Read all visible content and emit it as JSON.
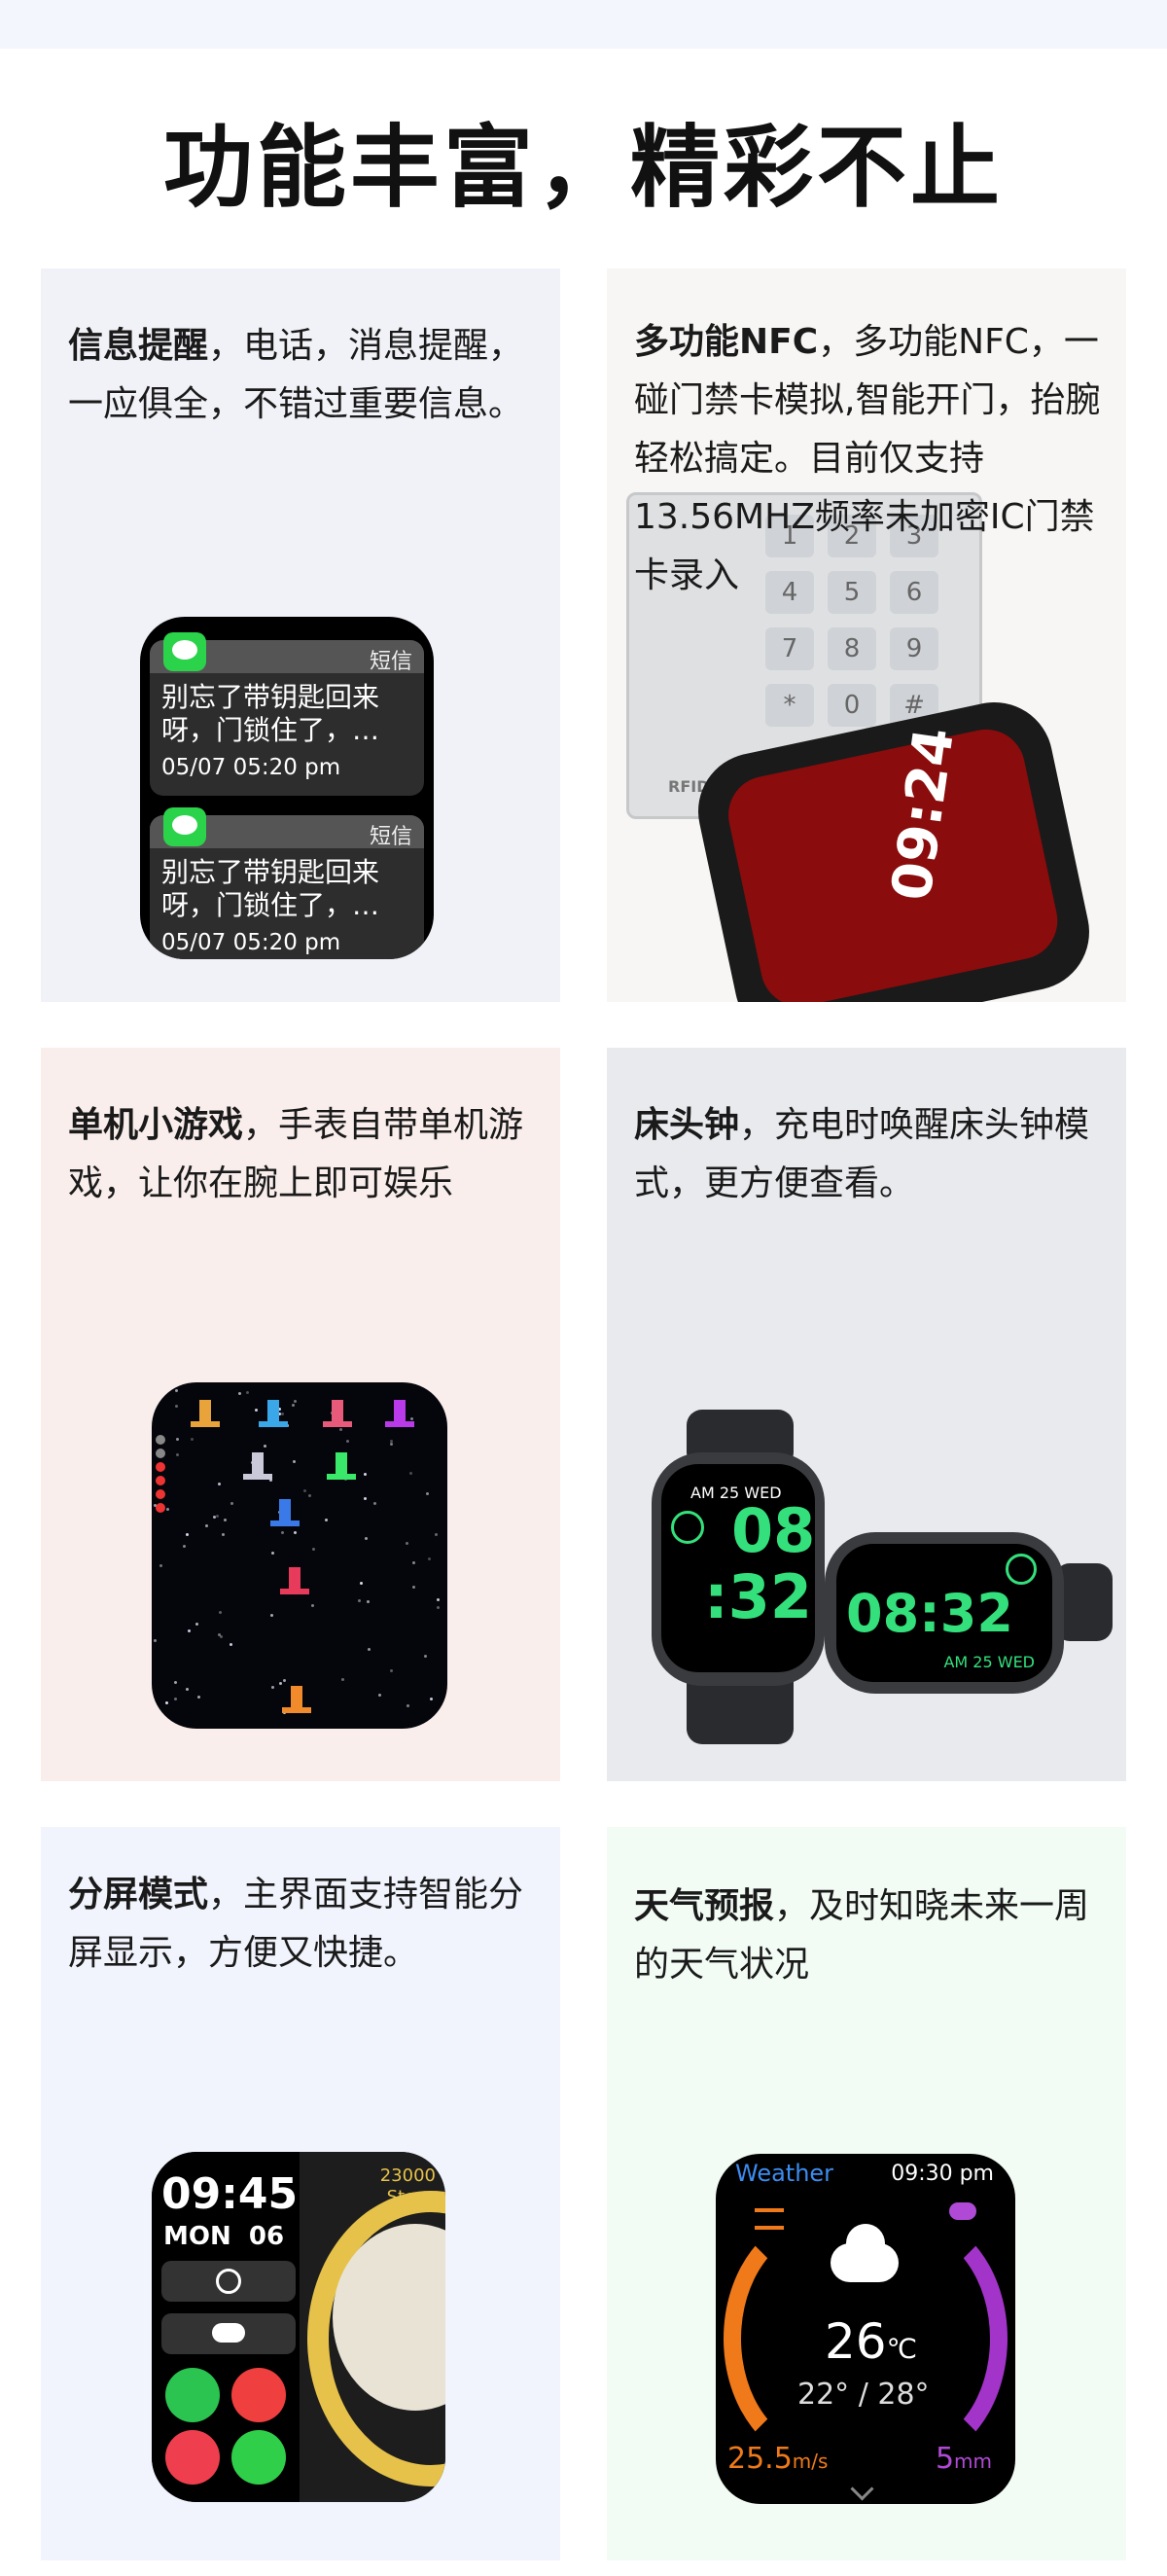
{
  "page_title": "功能丰富，精彩不止",
  "cards": [
    {
      "title_bold": "信息提醒",
      "text": "，电话，消息提醒，一应俱全，不错过重要信息。",
      "notifications": [
        {
          "source": "短信",
          "message": "别忘了带钥匙回来呀，门锁住了，…",
          "time": "05/07  05:20 pm"
        },
        {
          "source": "短信",
          "message": "别忘了带钥匙回来呀，门锁住了，…",
          "time": "05/07  05:20 pm"
        }
      ]
    },
    {
      "title_bold": "多功能NFC",
      "text": "，多功能NFC，一碰门禁卡模拟,智能开门，抬腕轻松搞定。目前仅支持13.56MHZ频率未加密IC门禁卡录入",
      "keypad_keys": [
        "1",
        "2",
        "3",
        "4",
        "5",
        "6",
        "7",
        "8",
        "9",
        "*",
        "0",
        "#"
      ],
      "keypad_label": "RFID ACCESS CONTROL",
      "watch_time": "09:24"
    },
    {
      "title_bold": "单机小游戏",
      "text": "，手表自带单机游戏，让你在腕上即可娱乐"
    },
    {
      "title_bold": "床头钟",
      "text": "，充电时唤醒床头钟模式，更方便查看。",
      "watch1": {
        "date": "AM 25 WED",
        "hour": "08",
        "minute": ":32"
      },
      "watch2": {
        "time": "08:32",
        "date": "AM 25 WED"
      }
    },
    {
      "title_bold": "分屏模式",
      "text": "，主界面支持智能分屏显示，方便又快捷。",
      "time": "09:45",
      "day": "MON",
      "date": "06",
      "steps": "23000",
      "steps_label": "Steps"
    },
    {
      "title_bold": "天气预报",
      "text": "，及时知晓未来一周的天气状况",
      "app": "Weather",
      "time": "09:30 pm",
      "temp": "26",
      "unit": "℃",
      "low": "22°",
      "high": "28°",
      "wind_value": "25.5",
      "wind_unit": "m/s",
      "rain_value": "5",
      "rain_unit": "mm"
    }
  ],
  "colors": {
    "accent_green": "#34e07c",
    "weather_orange": "#f07a1a",
    "weather_purple": "#a234c9"
  }
}
